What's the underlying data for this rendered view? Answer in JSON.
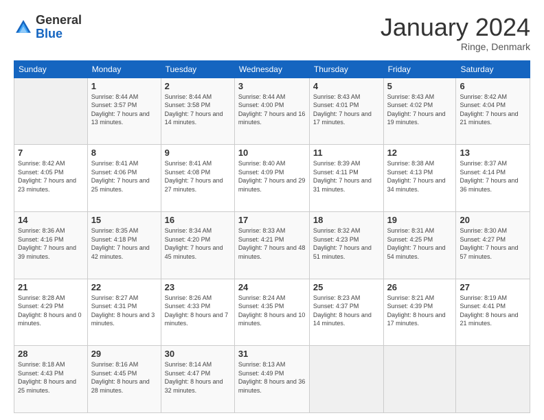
{
  "header": {
    "logo": {
      "general": "General",
      "blue": "Blue"
    },
    "title": "January 2024",
    "subtitle": "Ringe, Denmark"
  },
  "calendar": {
    "days_of_week": [
      "Sunday",
      "Monday",
      "Tuesday",
      "Wednesday",
      "Thursday",
      "Friday",
      "Saturday"
    ],
    "weeks": [
      [
        {
          "day": "",
          "sunrise": "",
          "sunset": "",
          "daylight": ""
        },
        {
          "day": "1",
          "sunrise": "Sunrise: 8:44 AM",
          "sunset": "Sunset: 3:57 PM",
          "daylight": "Daylight: 7 hours and 13 minutes."
        },
        {
          "day": "2",
          "sunrise": "Sunrise: 8:44 AM",
          "sunset": "Sunset: 3:58 PM",
          "daylight": "Daylight: 7 hours and 14 minutes."
        },
        {
          "day": "3",
          "sunrise": "Sunrise: 8:44 AM",
          "sunset": "Sunset: 4:00 PM",
          "daylight": "Daylight: 7 hours and 16 minutes."
        },
        {
          "day": "4",
          "sunrise": "Sunrise: 8:43 AM",
          "sunset": "Sunset: 4:01 PM",
          "daylight": "Daylight: 7 hours and 17 minutes."
        },
        {
          "day": "5",
          "sunrise": "Sunrise: 8:43 AM",
          "sunset": "Sunset: 4:02 PM",
          "daylight": "Daylight: 7 hours and 19 minutes."
        },
        {
          "day": "6",
          "sunrise": "Sunrise: 8:42 AM",
          "sunset": "Sunset: 4:04 PM",
          "daylight": "Daylight: 7 hours and 21 minutes."
        }
      ],
      [
        {
          "day": "7",
          "sunrise": "Sunrise: 8:42 AM",
          "sunset": "Sunset: 4:05 PM",
          "daylight": "Daylight: 7 hours and 23 minutes."
        },
        {
          "day": "8",
          "sunrise": "Sunrise: 8:41 AM",
          "sunset": "Sunset: 4:06 PM",
          "daylight": "Daylight: 7 hours and 25 minutes."
        },
        {
          "day": "9",
          "sunrise": "Sunrise: 8:41 AM",
          "sunset": "Sunset: 4:08 PM",
          "daylight": "Daylight: 7 hours and 27 minutes."
        },
        {
          "day": "10",
          "sunrise": "Sunrise: 8:40 AM",
          "sunset": "Sunset: 4:09 PM",
          "daylight": "Daylight: 7 hours and 29 minutes."
        },
        {
          "day": "11",
          "sunrise": "Sunrise: 8:39 AM",
          "sunset": "Sunset: 4:11 PM",
          "daylight": "Daylight: 7 hours and 31 minutes."
        },
        {
          "day": "12",
          "sunrise": "Sunrise: 8:38 AM",
          "sunset": "Sunset: 4:13 PM",
          "daylight": "Daylight: 7 hours and 34 minutes."
        },
        {
          "day": "13",
          "sunrise": "Sunrise: 8:37 AM",
          "sunset": "Sunset: 4:14 PM",
          "daylight": "Daylight: 7 hours and 36 minutes."
        }
      ],
      [
        {
          "day": "14",
          "sunrise": "Sunrise: 8:36 AM",
          "sunset": "Sunset: 4:16 PM",
          "daylight": "Daylight: 7 hours and 39 minutes."
        },
        {
          "day": "15",
          "sunrise": "Sunrise: 8:35 AM",
          "sunset": "Sunset: 4:18 PM",
          "daylight": "Daylight: 7 hours and 42 minutes."
        },
        {
          "day": "16",
          "sunrise": "Sunrise: 8:34 AM",
          "sunset": "Sunset: 4:20 PM",
          "daylight": "Daylight: 7 hours and 45 minutes."
        },
        {
          "day": "17",
          "sunrise": "Sunrise: 8:33 AM",
          "sunset": "Sunset: 4:21 PM",
          "daylight": "Daylight: 7 hours and 48 minutes."
        },
        {
          "day": "18",
          "sunrise": "Sunrise: 8:32 AM",
          "sunset": "Sunset: 4:23 PM",
          "daylight": "Daylight: 7 hours and 51 minutes."
        },
        {
          "day": "19",
          "sunrise": "Sunrise: 8:31 AM",
          "sunset": "Sunset: 4:25 PM",
          "daylight": "Daylight: 7 hours and 54 minutes."
        },
        {
          "day": "20",
          "sunrise": "Sunrise: 8:30 AM",
          "sunset": "Sunset: 4:27 PM",
          "daylight": "Daylight: 7 hours and 57 minutes."
        }
      ],
      [
        {
          "day": "21",
          "sunrise": "Sunrise: 8:28 AM",
          "sunset": "Sunset: 4:29 PM",
          "daylight": "Daylight: 8 hours and 0 minutes."
        },
        {
          "day": "22",
          "sunrise": "Sunrise: 8:27 AM",
          "sunset": "Sunset: 4:31 PM",
          "daylight": "Daylight: 8 hours and 3 minutes."
        },
        {
          "day": "23",
          "sunrise": "Sunrise: 8:26 AM",
          "sunset": "Sunset: 4:33 PM",
          "daylight": "Daylight: 8 hours and 7 minutes."
        },
        {
          "day": "24",
          "sunrise": "Sunrise: 8:24 AM",
          "sunset": "Sunset: 4:35 PM",
          "daylight": "Daylight: 8 hours and 10 minutes."
        },
        {
          "day": "25",
          "sunrise": "Sunrise: 8:23 AM",
          "sunset": "Sunset: 4:37 PM",
          "daylight": "Daylight: 8 hours and 14 minutes."
        },
        {
          "day": "26",
          "sunrise": "Sunrise: 8:21 AM",
          "sunset": "Sunset: 4:39 PM",
          "daylight": "Daylight: 8 hours and 17 minutes."
        },
        {
          "day": "27",
          "sunrise": "Sunrise: 8:19 AM",
          "sunset": "Sunset: 4:41 PM",
          "daylight": "Daylight: 8 hours and 21 minutes."
        }
      ],
      [
        {
          "day": "28",
          "sunrise": "Sunrise: 8:18 AM",
          "sunset": "Sunset: 4:43 PM",
          "daylight": "Daylight: 8 hours and 25 minutes."
        },
        {
          "day": "29",
          "sunrise": "Sunrise: 8:16 AM",
          "sunset": "Sunset: 4:45 PM",
          "daylight": "Daylight: 8 hours and 28 minutes."
        },
        {
          "day": "30",
          "sunrise": "Sunrise: 8:14 AM",
          "sunset": "Sunset: 4:47 PM",
          "daylight": "Daylight: 8 hours and 32 minutes."
        },
        {
          "day": "31",
          "sunrise": "Sunrise: 8:13 AM",
          "sunset": "Sunset: 4:49 PM",
          "daylight": "Daylight: 8 hours and 36 minutes."
        },
        {
          "day": "",
          "sunrise": "",
          "sunset": "",
          "daylight": ""
        },
        {
          "day": "",
          "sunrise": "",
          "sunset": "",
          "daylight": ""
        },
        {
          "day": "",
          "sunrise": "",
          "sunset": "",
          "daylight": ""
        }
      ]
    ]
  }
}
